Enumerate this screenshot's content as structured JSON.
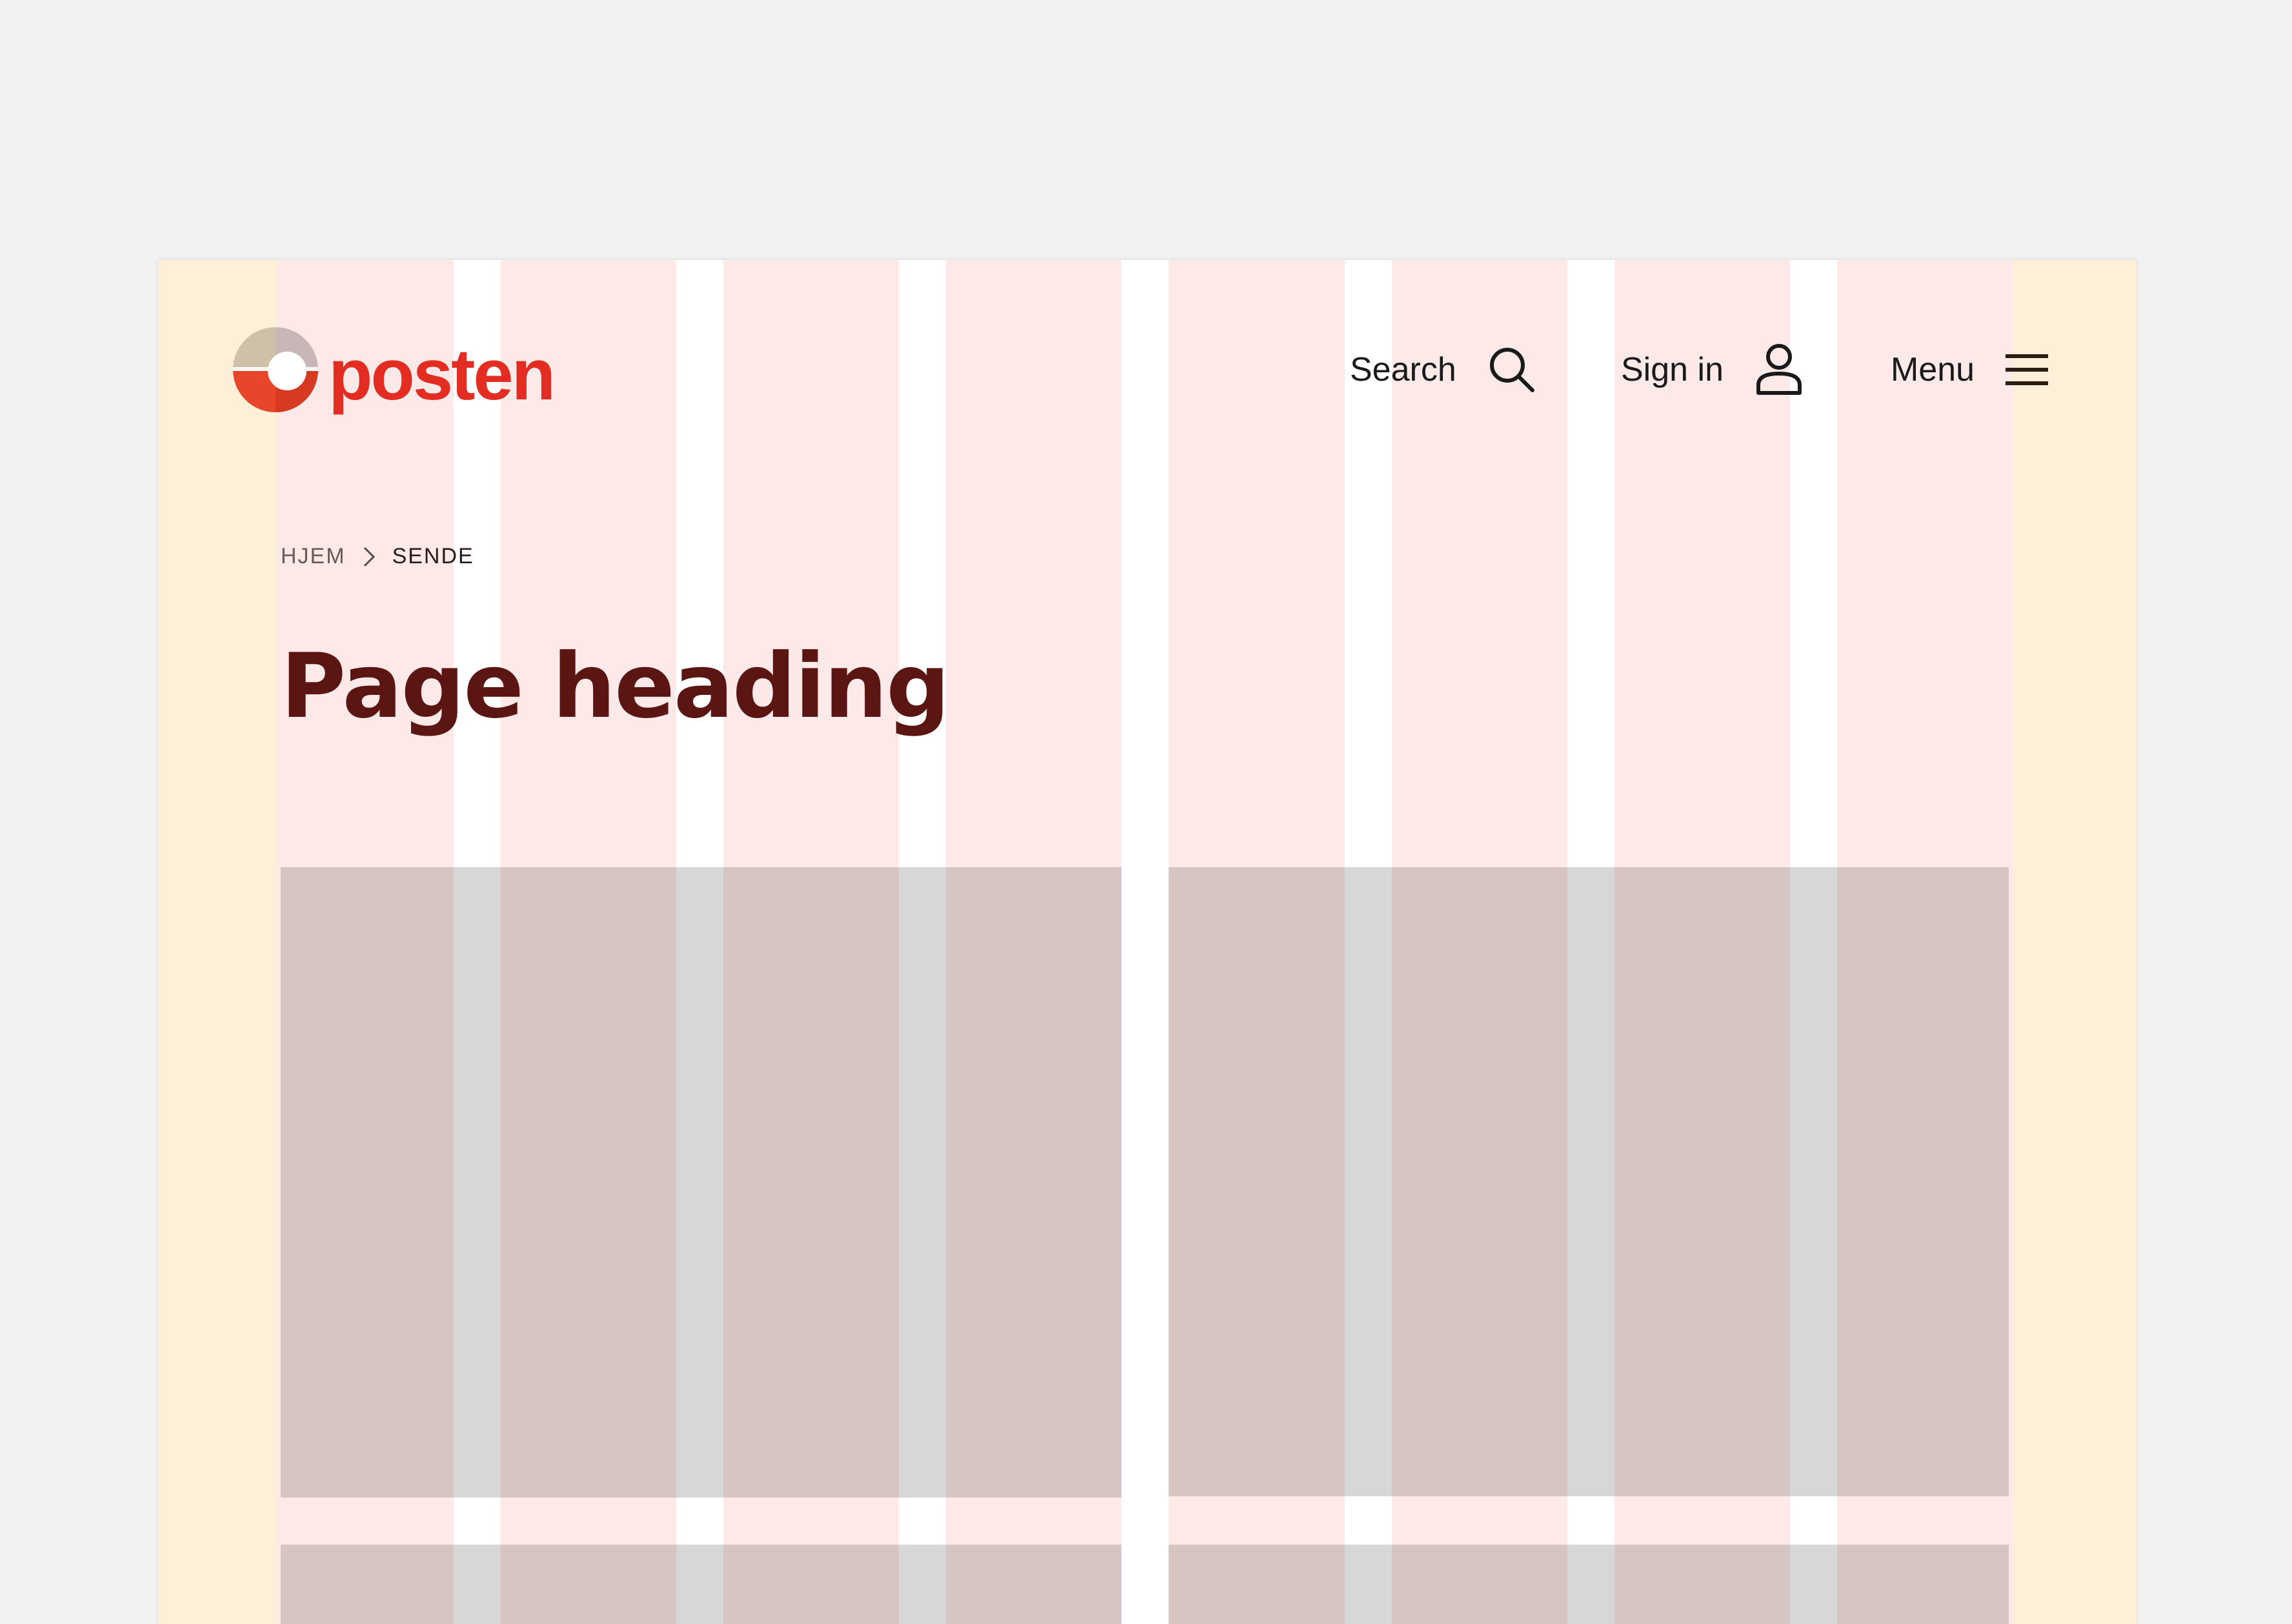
{
  "brand": {
    "name": "posten",
    "colors": {
      "red": "#e32d22",
      "beige": "#cfc1a8",
      "dark_red": "#5b1614"
    }
  },
  "header": {
    "search_label": "Search",
    "search_icon": "search-icon",
    "signin_label": "Sign in",
    "signin_icon": "user-icon",
    "menu_label": "Menu",
    "menu_icon": "hamburger-icon"
  },
  "breadcrumb": {
    "items": [
      "HJEM",
      "SENDE"
    ],
    "separator_icon": "chevron-right-icon"
  },
  "page": {
    "heading": "Page heading"
  },
  "grid_overlay": {
    "columns": 8,
    "colors": {
      "column": "#fce9e8",
      "margin": "#fef0d8",
      "gutter": "#ffffff",
      "content_block": "#d7c5c3"
    }
  }
}
